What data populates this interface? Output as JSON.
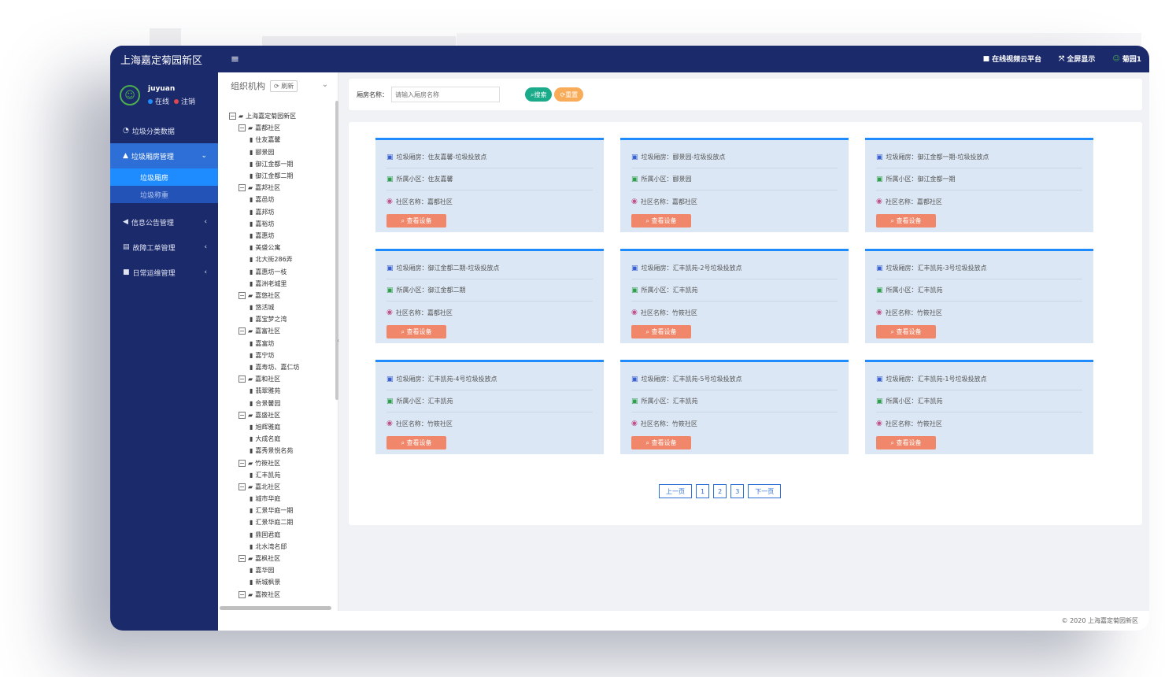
{
  "brand": "上海嘉定菊园新区",
  "topbar": {
    "links": [
      {
        "label": "在线视频云平台",
        "icon": "video-icon"
      },
      {
        "label": "全屏显示",
        "icon": "fullscreen-icon"
      },
      {
        "label": "菊园1",
        "icon": "user-icon"
      }
    ]
  },
  "user": {
    "name": "juyuan",
    "online": "在线",
    "logout": "注销"
  },
  "nav": {
    "garbage_data": "垃圾分类数据",
    "garbage_room_mgmt": "垃圾厢房管理",
    "sub_room": "垃圾厢房",
    "sub_weigh": "垃圾称重",
    "notice_mgmt": "信息公告管理",
    "fault_mgmt": "故障工单管理",
    "ops_mgmt": "日常运维管理"
  },
  "tree": {
    "title": "组织机构",
    "refresh": "刷新",
    "nodes": [
      {
        "level": 0,
        "type": "folder",
        "label": "上海嘉定菊园新区"
      },
      {
        "level": 1,
        "type": "folder",
        "label": "嘉都社区"
      },
      {
        "level": 2,
        "type": "file",
        "label": "住友嘉馨"
      },
      {
        "level": 2,
        "type": "file",
        "label": "郦景园"
      },
      {
        "level": 2,
        "type": "file",
        "label": "御江金都一期"
      },
      {
        "level": 2,
        "type": "file",
        "label": "御江金都二期"
      },
      {
        "level": 1,
        "type": "folder",
        "label": "嘉邦社区"
      },
      {
        "level": 2,
        "type": "file",
        "label": "嘉邑坊"
      },
      {
        "level": 2,
        "type": "file",
        "label": "嘉邦坊"
      },
      {
        "level": 2,
        "type": "file",
        "label": "嘉裕坊"
      },
      {
        "level": 2,
        "type": "file",
        "label": "嘉惠坊"
      },
      {
        "level": 2,
        "type": "file",
        "label": "美盛公寓"
      },
      {
        "level": 2,
        "type": "file",
        "label": "北大街286弄"
      },
      {
        "level": 2,
        "type": "file",
        "label": "嘉惠坊一枝"
      },
      {
        "level": 2,
        "type": "file",
        "label": "嘉洲老城里"
      },
      {
        "level": 1,
        "type": "folder",
        "label": "嘉悠社区"
      },
      {
        "level": 2,
        "type": "file",
        "label": "悠活城"
      },
      {
        "level": 2,
        "type": "file",
        "label": "嘉宝梦之湾"
      },
      {
        "level": 1,
        "type": "folder",
        "label": "嘉富社区"
      },
      {
        "level": 2,
        "type": "file",
        "label": "嘉富坊"
      },
      {
        "level": 2,
        "type": "file",
        "label": "嘉宁坊"
      },
      {
        "level": 2,
        "type": "file",
        "label": "嘉寿坊、嘉仁坊"
      },
      {
        "level": 1,
        "type": "folder",
        "label": "嘉和社区"
      },
      {
        "level": 2,
        "type": "file",
        "label": "翡翠雅苑"
      },
      {
        "level": 2,
        "type": "file",
        "label": "合景馨园"
      },
      {
        "level": 1,
        "type": "folder",
        "label": "嘉盛社区"
      },
      {
        "level": 2,
        "type": "file",
        "label": "旭辉雅庭"
      },
      {
        "level": 2,
        "type": "file",
        "label": "大成名庭"
      },
      {
        "level": 2,
        "type": "file",
        "label": "嘉秀景悦名苑"
      },
      {
        "level": 1,
        "type": "folder",
        "label": "竹筱社区"
      },
      {
        "level": 2,
        "type": "file",
        "label": "汇丰凯苑"
      },
      {
        "level": 1,
        "type": "folder",
        "label": "嘉北社区"
      },
      {
        "level": 2,
        "type": "file",
        "label": "城市华庭"
      },
      {
        "level": 2,
        "type": "file",
        "label": "汇景华庭一期"
      },
      {
        "level": 2,
        "type": "file",
        "label": "汇景华庭二期"
      },
      {
        "level": 2,
        "type": "file",
        "label": "鼎固君庭"
      },
      {
        "level": 2,
        "type": "file",
        "label": "北水湾名邸"
      },
      {
        "level": 1,
        "type": "folder",
        "label": "嘉枫社区"
      },
      {
        "level": 2,
        "type": "file",
        "label": "嘉华园"
      },
      {
        "level": 2,
        "type": "file",
        "label": "新城枫景"
      },
      {
        "level": 1,
        "type": "folder",
        "label": "嘉筱社区"
      }
    ]
  },
  "search": {
    "label": "厢房名称：",
    "placeholder": "请输入厢房名称",
    "search_btn": "搜索",
    "reset_btn": "重置"
  },
  "cards": [
    {
      "room": "垃圾厢房：住友嘉馨-垃圾投放点",
      "estate": "所属小区：住友嘉馨",
      "community": "社区名称：嘉都社区",
      "button": "查看设备"
    },
    {
      "room": "垃圾厢房：郦景园-垃圾投放点",
      "estate": "所属小区：郦景园",
      "community": "社区名称：嘉都社区",
      "button": "查看设备"
    },
    {
      "room": "垃圾厢房：御江金都一期-垃圾投放点",
      "estate": "所属小区：御江金都一期",
      "community": "社区名称：嘉都社区",
      "button": "查看设备"
    },
    {
      "room": "垃圾厢房：御江金都二期-垃圾投放点",
      "estate": "所属小区：御江金都二期",
      "community": "社区名称：嘉都社区",
      "button": "查看设备"
    },
    {
      "room": "垃圾厢房：汇丰凯苑-2号垃圾投放点",
      "estate": "所属小区：汇丰凯苑",
      "community": "社区名称：竹筱社区",
      "button": "查看设备"
    },
    {
      "room": "垃圾厢房：汇丰凯苑-3号垃圾投放点",
      "estate": "所属小区：汇丰凯苑",
      "community": "社区名称：竹筱社区",
      "button": "查看设备"
    },
    {
      "room": "垃圾厢房：汇丰凯苑-4号垃圾投放点",
      "estate": "所属小区：汇丰凯苑",
      "community": "社区名称：竹筱社区",
      "button": "查看设备"
    },
    {
      "room": "垃圾厢房：汇丰凯苑-5号垃圾投放点",
      "estate": "所属小区：汇丰凯苑",
      "community": "社区名称：竹筱社区",
      "button": "查看设备"
    },
    {
      "room": "垃圾厢房：汇丰凯苑-1号垃圾投放点",
      "estate": "所属小区：汇丰凯苑",
      "community": "社区名称：竹筱社区",
      "button": "查看设备"
    }
  ],
  "pager": {
    "prev": "上一页",
    "pages": [
      "1",
      "2",
      "3"
    ],
    "next": "下一页"
  },
  "footer": "© 2020 上海嘉定菊园新区",
  "colors": {
    "nav_bg": "#1b2a6b",
    "active": "#2d6fd6",
    "card_bg": "#dbe7f4",
    "card_btn": "#f0876a",
    "search_btn": "#1aab8a",
    "reset_btn": "#f8ac59"
  }
}
